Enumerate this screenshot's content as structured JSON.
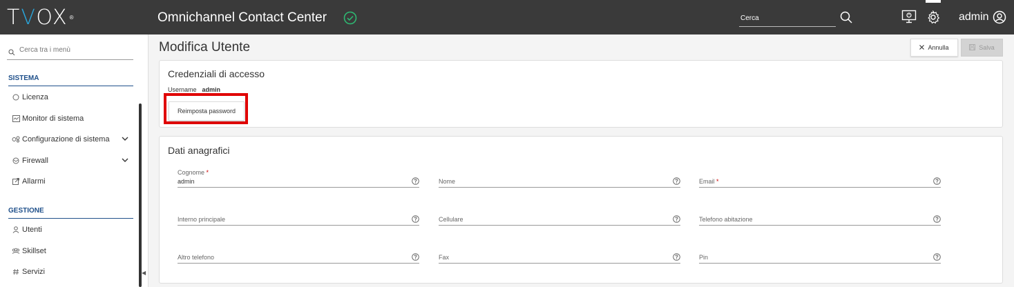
{
  "header": {
    "logo_prefix": "T",
    "logo_accent": "V",
    "logo_mid": "O",
    "logo_suffix": "X",
    "logo_reg": "®",
    "app_title": "Omnichannel Contact Center",
    "search_placeholder": "Cerca",
    "user_name": "admin"
  },
  "sidebar": {
    "search_placeholder": "Cerca tra i menù",
    "sections": [
      {
        "title": "SISTEMA",
        "items": [
          {
            "label": "Licenza",
            "icon": "circle-icon"
          },
          {
            "label": "Monitor di sistema",
            "icon": "monitor-chart-icon"
          },
          {
            "label": "Configurazione di sistema",
            "icon": "config-icon",
            "expandable": true
          },
          {
            "label": "Firewall",
            "icon": "firewall-icon",
            "expandable": true
          },
          {
            "label": "Allarmi",
            "icon": "alarm-icon"
          }
        ]
      },
      {
        "title": "GESTIONE",
        "items": [
          {
            "label": "Utenti",
            "icon": "user-icon"
          },
          {
            "label": "Skillset",
            "icon": "group-icon"
          },
          {
            "label": "Servizi",
            "icon": "hash-icon"
          }
        ]
      }
    ]
  },
  "main": {
    "page_title": "Modifica Utente",
    "cancel_label": "Annulla",
    "save_label": "Salva",
    "access": {
      "title": "Credenziali di accesso",
      "username_label": "Username",
      "username_value": "admin",
      "reset_label": "Reimposta password"
    },
    "personal": {
      "title": "Dati anagrafici",
      "fields": {
        "cognome": {
          "label": "Cognome",
          "required_mark": "*",
          "value": "admin"
        },
        "nome": {
          "label": "Nome"
        },
        "email": {
          "label": "Email",
          "required_mark": "*"
        },
        "interno": {
          "label": "Interno principale"
        },
        "cellulare": {
          "label": "Cellulare"
        },
        "telefono": {
          "label": "Telefono abitazione"
        },
        "altro": {
          "label": "Altro telefono"
        },
        "fax": {
          "label": "Fax"
        },
        "pin": {
          "label": "Pin"
        }
      }
    }
  },
  "colors": {
    "topbar": "#3a3a3a",
    "accent_blue": "#2aa4d9",
    "section_blue": "#1e4f8a",
    "ok_green": "#2eb872",
    "highlight_red": "#e00000",
    "required_red": "#cc0000"
  }
}
